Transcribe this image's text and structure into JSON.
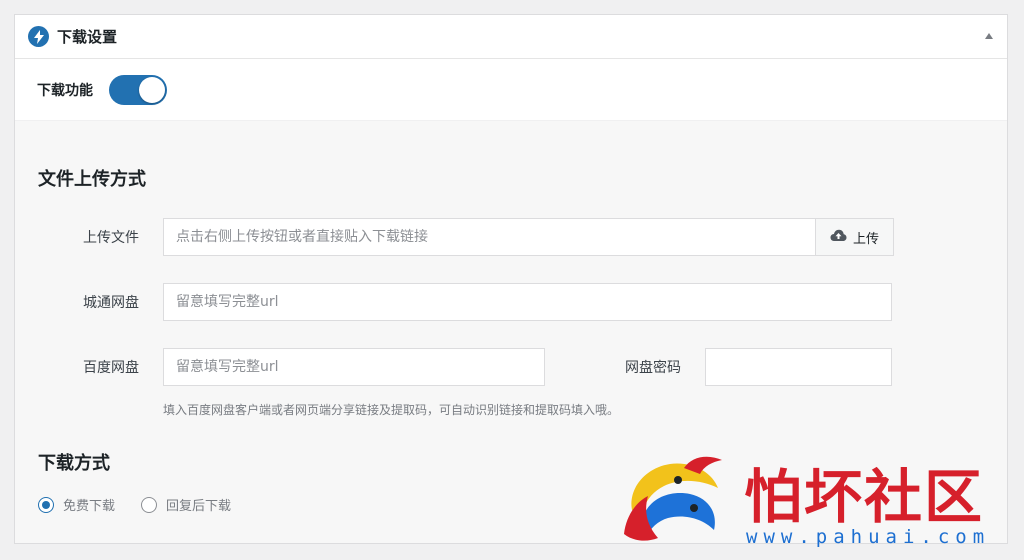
{
  "panel": {
    "title": "下载设置",
    "icon": "bolt-icon",
    "accent": "#2271b1"
  },
  "download_feature": {
    "label": "下载功能",
    "enabled": true
  },
  "upload_section": {
    "title": "文件上传方式",
    "upload_file": {
      "label": "上传文件",
      "placeholder": "点击右侧上传按钮或者直接贴入下载链接",
      "value": "",
      "button_label": "上传",
      "button_icon": "cloud-upload-icon"
    },
    "chengtong": {
      "label": "城通网盘",
      "placeholder": "留意填写完整url",
      "value": ""
    },
    "baidu": {
      "label": "百度网盘",
      "placeholder": "留意填写完整url",
      "value": ""
    },
    "baidu_password": {
      "label": "网盘密码",
      "value": ""
    },
    "hint": "填入百度网盘客户端或者网页端分享链接及提取码，可自动识别链接和提取码填入哦。"
  },
  "download_method": {
    "title": "下载方式",
    "options": [
      {
        "label": "免费下载",
        "checked": true
      },
      {
        "label": "回复后下载",
        "checked": false
      }
    ]
  },
  "watermark": {
    "text": "怕坏社区",
    "url": "www.pahuai.com"
  }
}
